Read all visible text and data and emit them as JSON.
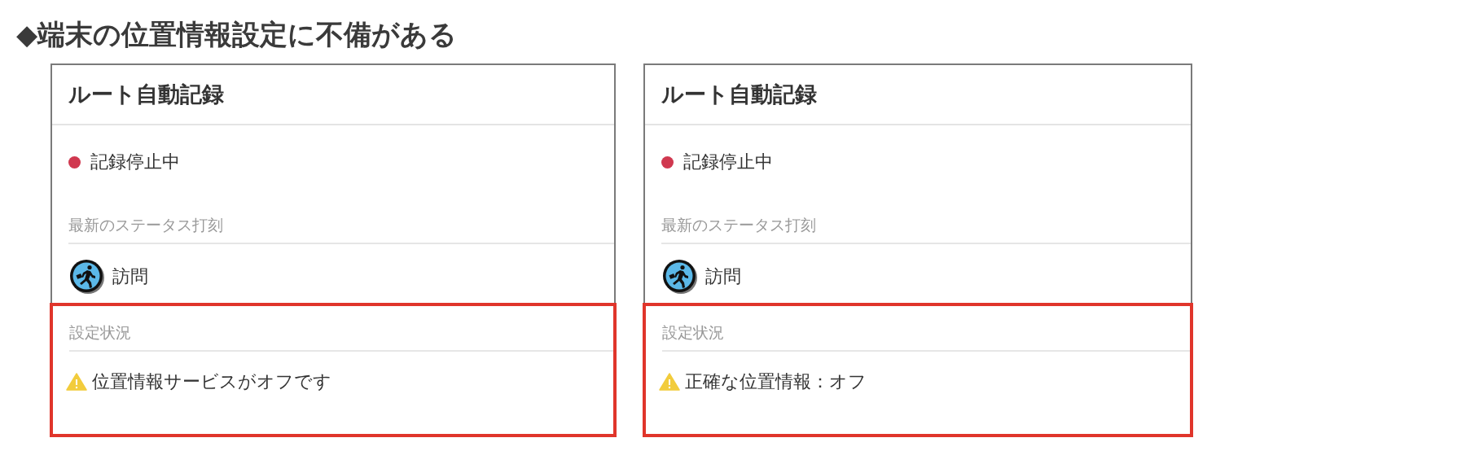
{
  "heading": "◆端末の位置情報設定に不備がある",
  "panels": [
    {
      "title": "ルート自動記録",
      "status": {
        "text": "記録停止中",
        "color": "#d0384f"
      },
      "latest_label": "最新のステータス打刻",
      "latest_status": {
        "text": "訪問"
      },
      "settings_label": "設定状況",
      "warning": "位置情報サービスがオフです",
      "highlighted": true
    },
    {
      "title": "ルート自動記録",
      "status": {
        "text": "記録停止中",
        "color": "#d0384f"
      },
      "latest_label": "最新のステータス打刻",
      "latest_status": {
        "text": "訪問"
      },
      "settings_label": "設定状況",
      "warning": "正確な位置情報：オフ",
      "highlighted": true
    }
  ]
}
